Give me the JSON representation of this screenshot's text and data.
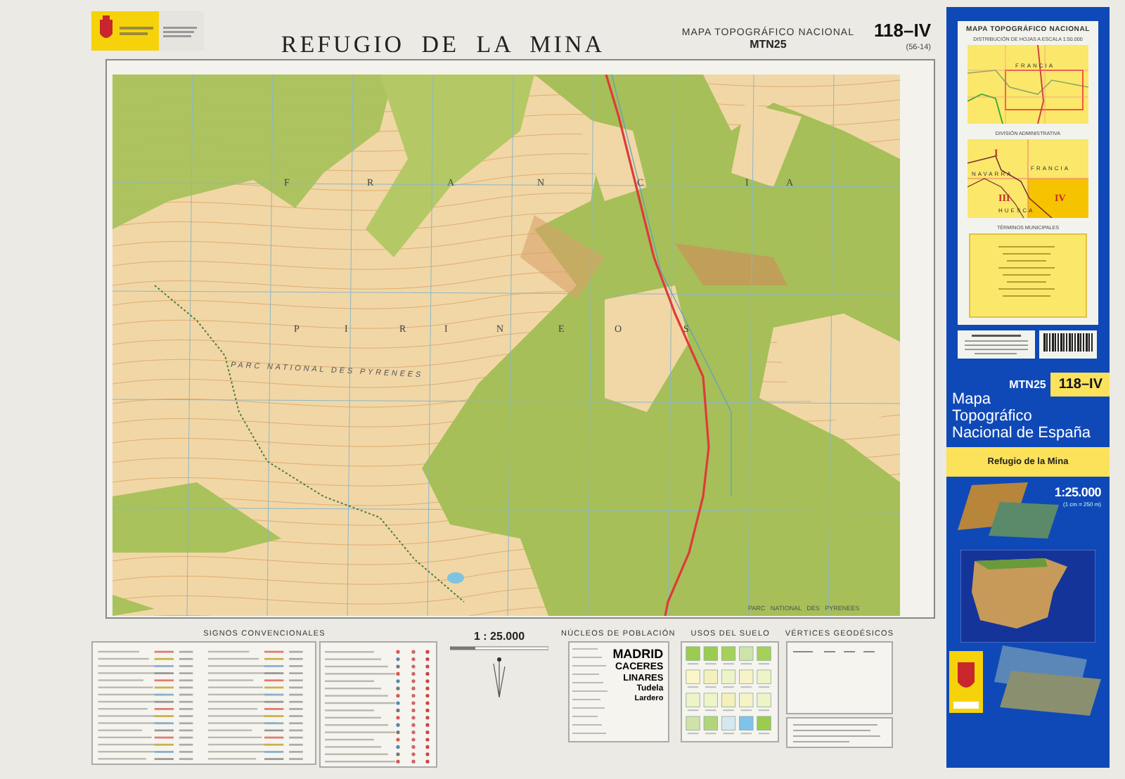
{
  "header": {
    "title": "REFUGIO DE LA MINA",
    "series": "MAPA TOPOGRÁFICO NACIONAL",
    "series_code": "MTN25",
    "sheet": "118–IV",
    "sheet_ref": "(56-14)"
  },
  "map": {
    "country_letters": [
      "F",
      "R",
      "A",
      "N",
      "C",
      "I",
      "A"
    ],
    "range_letters": [
      "P",
      "I",
      "R",
      "I",
      "N",
      "E",
      "O",
      "S"
    ],
    "park_labels": [
      "PARC NATIONAL DES PYRENEES",
      "PARC   NATIONAL   DES   PYRENEES"
    ]
  },
  "legend": {
    "signs_title": "SIGNOS CONVENCIONALES",
    "scale": "1 : 25.000",
    "population_title": "NÚCLEOS DE POBLACIÓN",
    "population_names": [
      "MADRID",
      "CACERES",
      "LINARES",
      "Tudela",
      "Lardero"
    ],
    "land_use_title": "USOS DEL SUELO",
    "vertices_title": "VÉRTICES GEODÉSICOS"
  },
  "cover": {
    "index_title": "MAPA TOPOGRÁFICO NACIONAL",
    "index_subtitle": "DISTRIBUCIÓN DE HOJAS A ESCALA 1:50.000",
    "index_country": "FRANCIA",
    "admin_title": "DIVISIÓN ADMINISTRATIVA",
    "admin_labels": [
      "I",
      "NAVARRA",
      "FRANCIA",
      "III",
      "HUESCA",
      "IV"
    ],
    "municipal_title": "TÉRMINOS MUNICIPALES",
    "series_code": "MTN25",
    "sheet": "118–IV",
    "title_lines": [
      "Mapa",
      "Topográfico",
      "Nacional de España"
    ],
    "sheet_name": "Refugio de la Mina",
    "scale": "1:25.000",
    "scale_note": "(1 cm = 250 m)"
  }
}
